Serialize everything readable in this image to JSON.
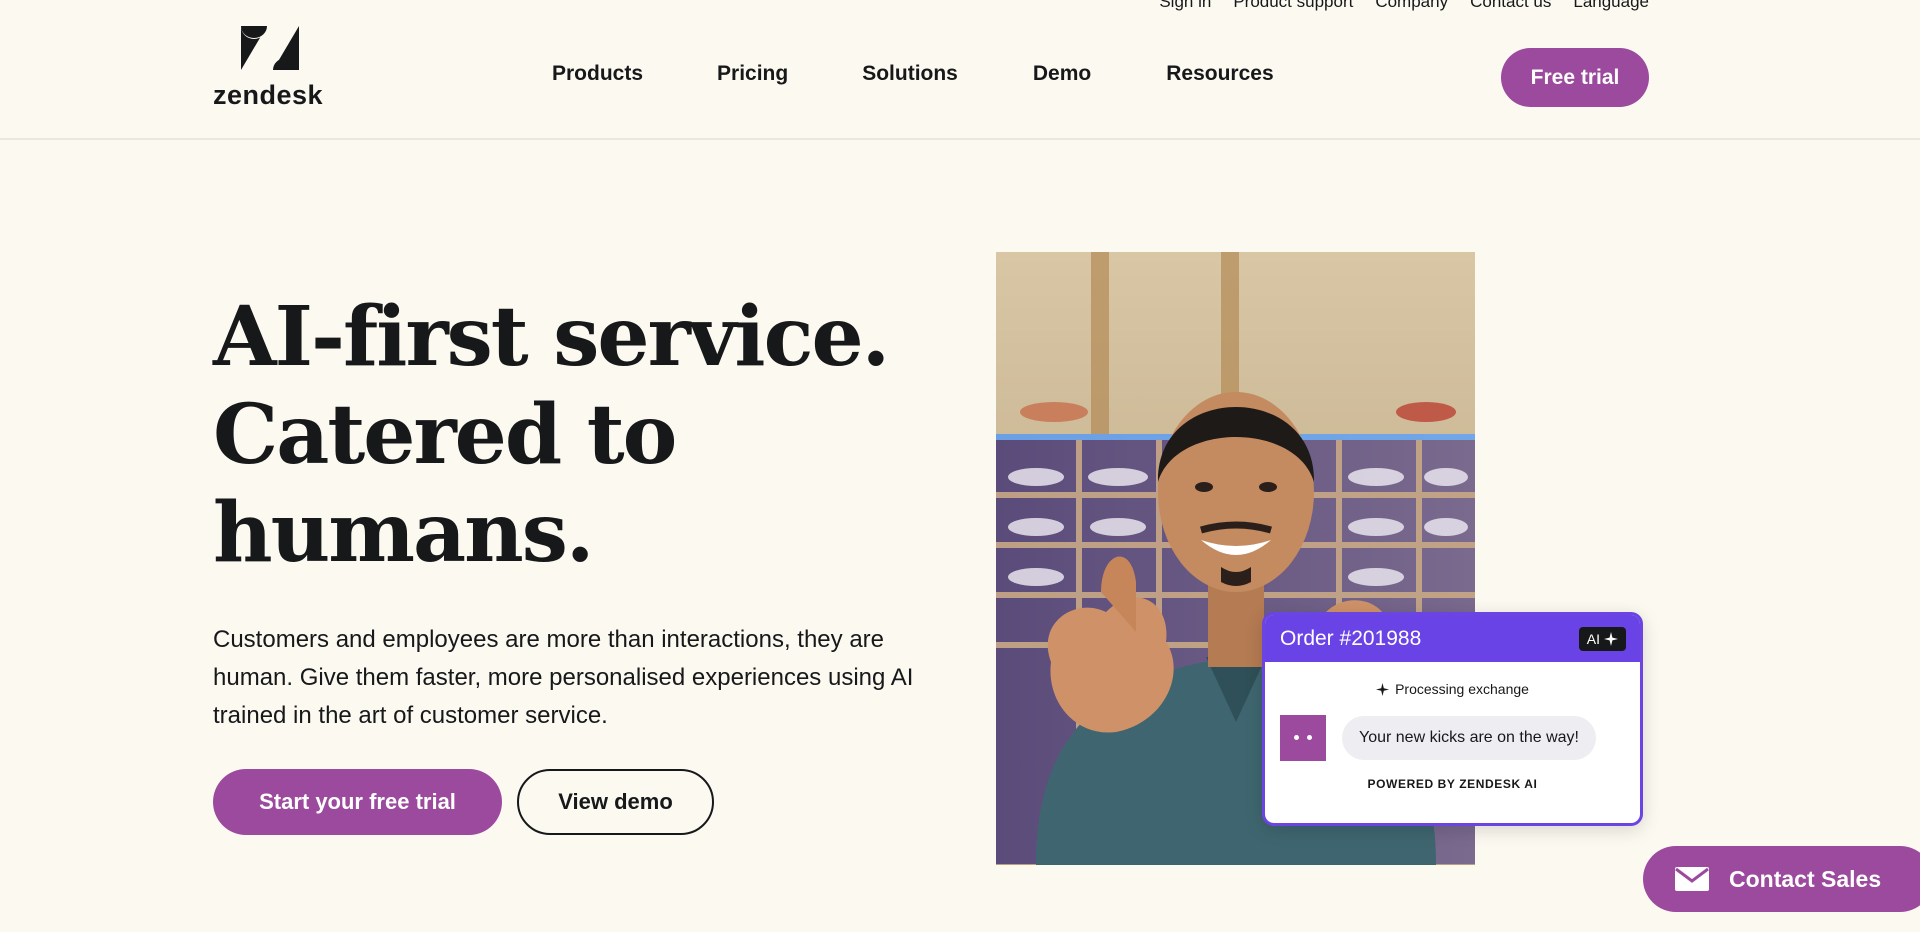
{
  "utility_nav": [
    "Sign in",
    "Product support",
    "Company",
    "Contact us",
    "Language"
  ],
  "brand": {
    "name": "zendesk"
  },
  "nav": [
    "Products",
    "Pricing",
    "Solutions",
    "Demo",
    "Resources"
  ],
  "header_cta": "Free trial",
  "hero": {
    "headline": [
      "AI-first service.",
      "Catered to",
      "humans."
    ],
    "subcopy": "Customers and employees are more than interactions, they are human. Give them faster, more personalised experiences using AI trained in the art of customer service.",
    "primary_cta": "Start your free trial",
    "secondary_cta": "View demo"
  },
  "order_card": {
    "title": "Order #201988",
    "badge": "AI",
    "status": "Processing exchange",
    "message": "Your new kicks are on the way!",
    "footer": "POWERED BY ZENDESK AI"
  },
  "contact_sales": "Contact Sales",
  "colors": {
    "background": "#fcf9f1",
    "brand_purple": "#9b4a9d",
    "ai_violet": "#6a43e6",
    "text": "#17181a"
  },
  "icons": {
    "logo": "zendesk-logo-icon",
    "sparkle": "sparkle-icon",
    "mail": "mail-icon"
  }
}
